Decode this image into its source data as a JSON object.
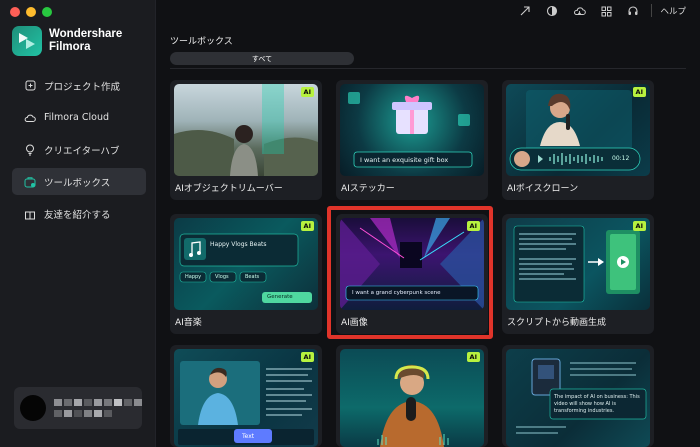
{
  "app": {
    "name_line1": "Wondershare",
    "name_line2": "Filmora"
  },
  "sidebar": {
    "items": [
      {
        "label": "プロジェクト作成",
        "icon": "new-project-icon"
      },
      {
        "label": "Filmora Cloud",
        "icon": "cloud-icon"
      },
      {
        "label": "クリエイターハブ",
        "icon": "lightbulb-icon"
      },
      {
        "label": "ツールボックス",
        "icon": "toolbox-icon",
        "active": true
      },
      {
        "label": "友達を紹介する",
        "icon": "gift-icon"
      }
    ]
  },
  "topbar": {
    "icons": [
      "upload-icon",
      "theme-icon",
      "cloud-download-icon",
      "grid-icon",
      "headset-icon"
    ],
    "help_label": "ヘルプ"
  },
  "main": {
    "section_title": "ツールボックス",
    "filter_label": "すべて",
    "ai_badge": "AI",
    "cards": [
      {
        "label": "AIオブジェクトリムーバー"
      },
      {
        "label": "AIステッカー",
        "caption": "I want an exquisite gift box"
      },
      {
        "label": "AIボイスクローン",
        "time": "00:12"
      },
      {
        "label": "AI音楽",
        "track_title": "Happy Vlogs Beats",
        "tags": [
          "Happy",
          "Vlogs",
          "Beats"
        ],
        "button": "Generate"
      },
      {
        "label": "AI画像",
        "prompt": "I want a grand cyberpunk scene"
      },
      {
        "label": "スクリプトから動画生成"
      },
      {
        "label": "",
        "button": "Text"
      },
      {
        "label": ""
      },
      {
        "label": "",
        "caption": "The impact of AI on business: This video will show how AI is transforming industries."
      }
    ]
  },
  "colors": {
    "accent": "#21c2a4",
    "badge": "#b7f23f",
    "highlight": "#e0342a"
  }
}
